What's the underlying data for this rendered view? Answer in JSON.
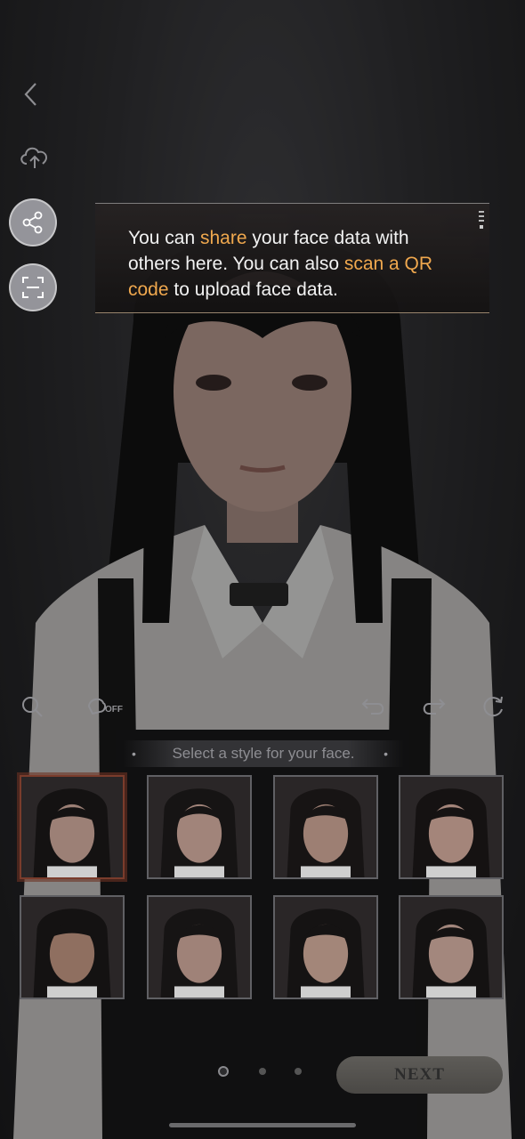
{
  "tooltip": {
    "part1": "You can ",
    "share": "share",
    "part2": " your face data with others here. You can also ",
    "scan": "scan a QR code",
    "part3": " to upload face data."
  },
  "toolbar": {
    "beauty_state": "OFF"
  },
  "style_section": {
    "hint": "Select a style for your face."
  },
  "style_tiles": [
    {
      "id": "style-1",
      "selected": true
    },
    {
      "id": "style-2",
      "selected": false
    },
    {
      "id": "style-3",
      "selected": false
    },
    {
      "id": "style-4",
      "selected": false
    },
    {
      "id": "style-5",
      "selected": false
    },
    {
      "id": "style-6",
      "selected": false
    },
    {
      "id": "style-7",
      "selected": false
    },
    {
      "id": "style-8",
      "selected": false
    }
  ],
  "pager": {
    "pages": 3,
    "active": 1
  },
  "footer": {
    "next_label": "NEXT"
  },
  "colors": {
    "highlight": "#f0a84e",
    "selected_border": "#7a3c2c"
  },
  "icons": [
    "back-icon",
    "cloud-upload-icon",
    "share-icon",
    "scan-qr-icon",
    "search-icon",
    "beauty-filter-icon",
    "undo-icon",
    "redo-icon",
    "reset-icon"
  ]
}
